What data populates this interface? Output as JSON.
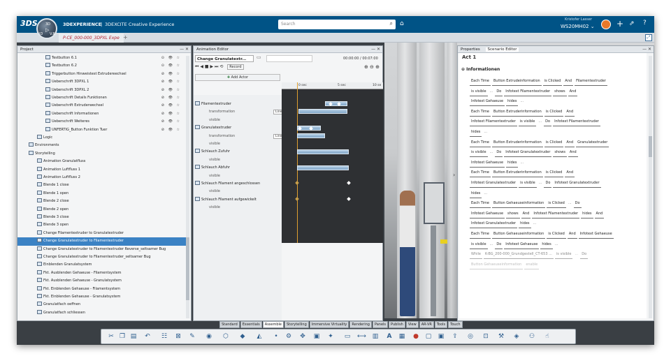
{
  "app": {
    "brand": "3DEXPERIENCE",
    "separator": "|",
    "product": "3DEXCITE Creative Experience",
    "compass_labels": [
      "3D",
      "ID",
      "V.R"
    ],
    "search_placeholder": "Search",
    "user_top": "Kristofer Lasser",
    "user_bottom": "WS20MH02 ⌄",
    "tab_title": "P-CE_000-000_3DPXL Expe",
    "tab_add": "+"
  },
  "project": {
    "title": "Project",
    "rows": [
      {
        "label": "Testbutton 6.1",
        "indent": 3,
        "icons": "⊙ 👁 ☆"
      },
      {
        "label": "Testbutton 6.2",
        "indent": 3,
        "icons": "⊙ 👁 ☆"
      },
      {
        "label": "Triggerbutton Hinweistest Extrudereechsel",
        "indent": 3,
        "icons": "⊘ 👁 ☆"
      },
      {
        "label": "Ueberschrift 3DPXL 1",
        "indent": 3,
        "icons": "⊘ 👁 ☆"
      },
      {
        "label": "Ueberschrift 3DPXL 2",
        "indent": 3,
        "icons": "⊘ 👁 ☆"
      },
      {
        "label": "Ueberschrift Details Funktionen",
        "indent": 3,
        "icons": "⊘ 👁 ☆"
      },
      {
        "label": "Ueberschrift Extruderwechsel",
        "indent": 3,
        "icons": "⊘ 👁 ☆"
      },
      {
        "label": "Ueberschrift Informationen",
        "indent": 3,
        "icons": "⊘ 👁 ☆"
      },
      {
        "label": "Ueberschrift Weiteres",
        "indent": 3,
        "icons": "⊘ 👁 ☆"
      },
      {
        "label": "UNFERTIG_Button Funktion Tuer",
        "indent": 3,
        "icons": "⊘ 👁 ☆"
      },
      {
        "label": "Logic",
        "indent": 2,
        "icons": ""
      },
      {
        "label": "Environments",
        "indent": 1,
        "icons": ""
      },
      {
        "label": "Storytelling",
        "indent": 1,
        "icons": ""
      },
      {
        "label": "Animation Granulatfluss",
        "indent": 2,
        "icons": ""
      },
      {
        "label": "Animation Luftfluss 1",
        "indent": 2,
        "icons": ""
      },
      {
        "label": "Animation Luftfluss 2",
        "indent": 2,
        "icons": ""
      },
      {
        "label": "Blende 1 close",
        "indent": 2,
        "icons": ""
      },
      {
        "label": "Blende 1 open",
        "indent": 2,
        "icons": ""
      },
      {
        "label": "Blende 2 close",
        "indent": 2,
        "icons": ""
      },
      {
        "label": "Blende 2 open",
        "indent": 2,
        "icons": ""
      },
      {
        "label": "Blende 3 close",
        "indent": 2,
        "icons": ""
      },
      {
        "label": "Blende 3 open",
        "indent": 2,
        "icons": ""
      },
      {
        "label": "Change Filamentextruder to Granulatextruder",
        "indent": 2,
        "icons": ""
      },
      {
        "label": "Change Granulatextruder to Filamentextruder",
        "indent": 2,
        "icons": "",
        "selected": true
      },
      {
        "label": "Change Granulatextruder to Filamentextruder Reverse_seltsamer Bug",
        "indent": 2,
        "icons": ""
      },
      {
        "label": "Change Granulatextruder to Filamentextruder_seltsamer Bug",
        "indent": 2,
        "icons": ""
      },
      {
        "label": "Einblenden Granulatsystem",
        "indent": 2,
        "icons": ""
      },
      {
        "label": "Fkt. Ausblenden Gehaeuse - Filamentsystem",
        "indent": 2,
        "icons": ""
      },
      {
        "label": "Fkt. Ausblenden Gehaeuse - Granulatsystem",
        "indent": 2,
        "icons": ""
      },
      {
        "label": "Fkt. Einblenden Gehaeuse - Filamentsystem",
        "indent": 2,
        "icons": ""
      },
      {
        "label": "Fkt. Einblenden Gehaeuse - Granulatsystem",
        "indent": 2,
        "icons": ""
      },
      {
        "label": "Granulatfach oeffnen",
        "indent": 2,
        "icons": ""
      },
      {
        "label": "Granulatfach schliessen",
        "indent": 2,
        "icons": ""
      }
    ]
  },
  "animation": {
    "title": "Animation Editor",
    "sequence": "Change Granulatextr...",
    "time": "00:00:00 / 00:07:00",
    "record": "Record",
    "add_actor": "Add Actor",
    "ruler": [
      "0 sec",
      "5 sec",
      "10 se"
    ],
    "tracks": [
      {
        "label": "Filamentextruder",
        "kind": "actor"
      },
      {
        "label": "transformation",
        "kind": "prop",
        "dropdown": "Linear"
      },
      {
        "label": "visible",
        "kind": "prop"
      },
      {
        "label": "Granulatextruder",
        "kind": "actor"
      },
      {
        "label": "transformation",
        "kind": "prop",
        "dropdown": "Linear"
      },
      {
        "label": "visible",
        "kind": "prop"
      },
      {
        "label": "Schlauch Zufuhr",
        "kind": "actor"
      },
      {
        "label": "visible",
        "kind": "prop"
      },
      {
        "label": "Schlauch Abfuhr",
        "kind": "actor"
      },
      {
        "label": "visible",
        "kind": "prop"
      },
      {
        "label": "Schlauch Filament angeschlossen",
        "kind": "actor"
      },
      {
        "label": "visible",
        "kind": "prop"
      },
      {
        "label": "Schlauch Filament aufgewickelt",
        "kind": "actor"
      },
      {
        "label": "visible",
        "kind": "prop"
      }
    ]
  },
  "scenario": {
    "tab_properties": "Properties",
    "tab_scenario": "Scenario Editor",
    "act": "Act 1",
    "section": "Informationen",
    "lines": [
      [
        "Each Time",
        "Button Extrudeinformation",
        "is Clicked",
        "And",
        "Filamentextruder"
      ],
      [
        "is visible",
        "...",
        "Do",
        "Infotext Filamentextruder",
        "shows",
        "And"
      ],
      [
        "Infotext Gehaeuse",
        "hides",
        "..."
      ],
      [
        "Each Time",
        "Button Extruderinformation",
        "is Clicked",
        "And"
      ],
      [
        "Infotext Filamentextruder",
        "is visible",
        "...",
        "Do",
        "Infotext Filamentextruder"
      ],
      [
        "hides",
        "..."
      ],
      [
        "Each Time",
        "Button Extruderinformation",
        "is Clicked",
        "And",
        "Granulatextruder"
      ],
      [
        "is visible",
        "...",
        "Do",
        "Infotext Granulatextruder",
        "shows",
        "And"
      ],
      [
        "Infotext Gehaeuse",
        "hides",
        "..."
      ],
      [
        "Each Time",
        "Button Extruderinformation",
        "is Clicked",
        "And"
      ],
      [
        "Infotext Granulatextruder",
        "is visible",
        "...",
        "Do",
        "Infotext Granulatextruder"
      ],
      [
        "hides",
        "..."
      ],
      [
        "Each Time",
        "Button Gehaeuseinformation",
        "is Clicked",
        "...",
        "Do"
      ],
      [
        "Infotext Gehaeuse",
        "shows",
        "And",
        "Infotext Filamentextruder",
        "hides",
        "And"
      ],
      [
        "Infotext Granulatextruder",
        "hides",
        "..."
      ],
      [
        "Each Time",
        "Button Gehaeuseinformation",
        "is Clicked",
        "And",
        "Infotext Gehaeuse"
      ],
      [
        "is visible",
        "...",
        "Do",
        "Infotext Gehaeuse",
        "hides",
        "..."
      ],
      [
        "While",
        "K-BG_200-000_Grundgestell_CT-653 ...",
        "is visible",
        "...",
        "Do"
      ],
      [
        "Button Gehaeuseinformation",
        "enable"
      ]
    ]
  },
  "bottom_tabs": [
    "Standard",
    "Essentials",
    "Assemble",
    "Storytelling",
    "Immersive Virtuality",
    "Rendering",
    "Panels",
    "Publish",
    "View",
    "AR-VR",
    "Tools",
    "Touch"
  ],
  "active_bottom_tab": "Assemble"
}
